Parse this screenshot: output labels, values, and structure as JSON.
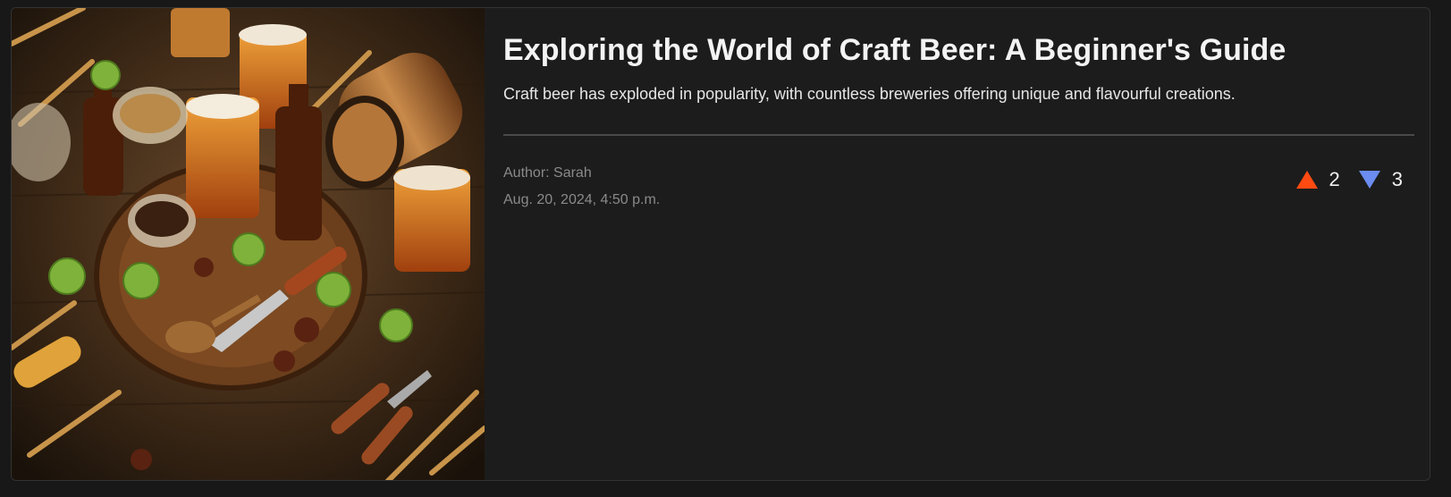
{
  "post": {
    "title": "Exploring the World of Craft Beer: A Beginner's Guide",
    "summary": "Craft beer has exploded in popularity, with countless breweries offering unique and flavourful creations.",
    "author": "Author: Sarah",
    "date": "Aug. 20, 2024, 4:50 p.m.",
    "image_subject": "craft beer glasses, barrel, hops, wheat and spices on a wooden table"
  },
  "votes": {
    "upvote_icon": "triangle-up-icon",
    "upvote_color": "#ff4a12",
    "upvotes": "2",
    "downvote_icon": "triangle-down-icon",
    "downvote_color": "#6b8cf0",
    "downvotes": "3"
  }
}
